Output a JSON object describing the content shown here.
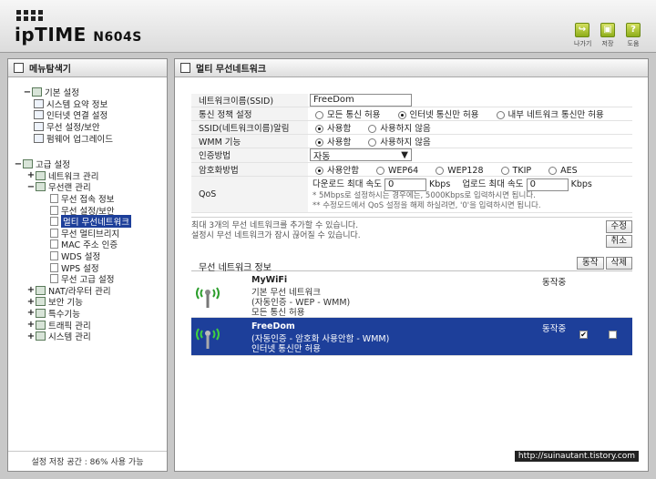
{
  "header": {
    "brand": "ipTIME",
    "model": "N604S",
    "tools": [
      {
        "label": "나가기",
        "icon": "logout-icon",
        "glyph": "↪"
      },
      {
        "label": "저장",
        "icon": "save-icon",
        "glyph": "▣"
      },
      {
        "label": "도움",
        "icon": "help-icon",
        "glyph": "?"
      }
    ]
  },
  "sidebar": {
    "title": "메뉴탐색기",
    "basic": {
      "label": "기본 설정",
      "items": [
        "시스템 요약 정보",
        "인터넷 연결 설정",
        "무선 설정/보안",
        "펌웨어 업그레이드"
      ]
    },
    "advanced": {
      "label": "고급 설정",
      "network": "네트워크 관리",
      "wireless": "무선랜 관리",
      "wireless_items": [
        "무선 접속 정보",
        "무선 설정/보안",
        "멀티 무선네트워크",
        "무선 멀티브리지",
        "MAC 주소 인증",
        "WDS 설정",
        "WPS 설정",
        "무선 고급 설정"
      ],
      "others": [
        "NAT/라우터 관리",
        "보안 기능",
        "특수기능",
        "트래픽 관리",
        "시스템 관리"
      ]
    },
    "storage": "설정 저장 공간 : 86% 사용 가능"
  },
  "main": {
    "title": "멀티 무선네트워크",
    "form": {
      "ssid_label": "네트워크이름(SSID)",
      "ssid_value": "FreeDom",
      "policy_label": "통신 정책 설정",
      "policy_options": [
        "모든 통신 허용",
        "인터넷 통신만 허용",
        "내부 네트워크 통신만 허용"
      ],
      "broadcast_label": "SSID(네트워크이름)알림",
      "broadcast_options": [
        "사용함",
        "사용하지 않음"
      ],
      "wmm_label": "WMM 기능",
      "wmm_options": [
        "사용함",
        "사용하지 않음"
      ],
      "auth_label": "인증방법",
      "auth_value": "자동",
      "enc_label": "암호화방법",
      "enc_options": [
        "사용안함",
        "WEP64",
        "WEP128",
        "TKIP",
        "AES"
      ],
      "qos_label": "QoS",
      "qos_down_label": "다운로드 최대 속도",
      "qos_down_value": "0",
      "qos_up_label": "업로드 최대 속도",
      "qos_up_value": "0",
      "qos_unit": "Kbps",
      "qos_note1": "* 5Mbps로 설정하시는 경우에는, 5000Kbps로 입력하시면 됩니다.",
      "qos_note2": "** 수정모드에서 QoS 설정을 해제 하실려면, '0'을 입력하시면 됩니다."
    },
    "info_line1": "최대 3개의 무선 네트워크를 추가할 수 있습니다.",
    "info_line2": "설정시 무선 네트워크가 잠시 끊어질 수 있습니다.",
    "edit_button": "수정",
    "cancel_button": "취소",
    "list_title": "무선 네트워크 정보",
    "action_button": "동작",
    "delete_button": "삭제",
    "networks": [
      {
        "name": "MyWiFi",
        "d1": "기본 무선 네트워크",
        "d2": "(자동인증 - WEP - WMM)",
        "d3": "모든 통신 허용",
        "status": "동작중"
      },
      {
        "name": "FreeDom",
        "d1": "(자동인증 - 암호화 사용안함 - WMM)",
        "d2": "인터넷 통신만 허용",
        "status": "동작중"
      }
    ]
  },
  "watermark": "http://suinautant.tistory.com"
}
